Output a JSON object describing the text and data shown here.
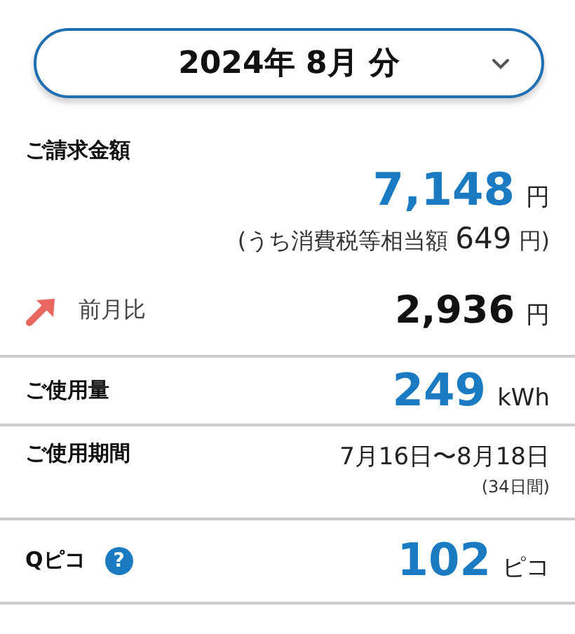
{
  "period_selector": {
    "label": "2024年 8月 分"
  },
  "billing": {
    "label": "ご請求金額",
    "amount": "7,148",
    "unit": "円",
    "tax_prefix": "(うち消費税等相当額",
    "tax_amount": "649",
    "tax_unit": "円)"
  },
  "rows": [
    {
      "kind": "comparison",
      "label": "前月比",
      "increase": true,
      "value": "2,936",
      "unit": "円",
      "accent": false
    },
    {
      "kind": "amount",
      "label": "ご使用量",
      "value": "249",
      "unit": "kWh",
      "accent": true
    },
    {
      "kind": "period",
      "label": "ご使用期間",
      "value": "7月16日〜8月18日",
      "note": "(34日間)"
    },
    {
      "kind": "points",
      "label": "Qピコ",
      "help": "?",
      "value": "102",
      "unit": "ピコ",
      "accent": true
    }
  ]
}
